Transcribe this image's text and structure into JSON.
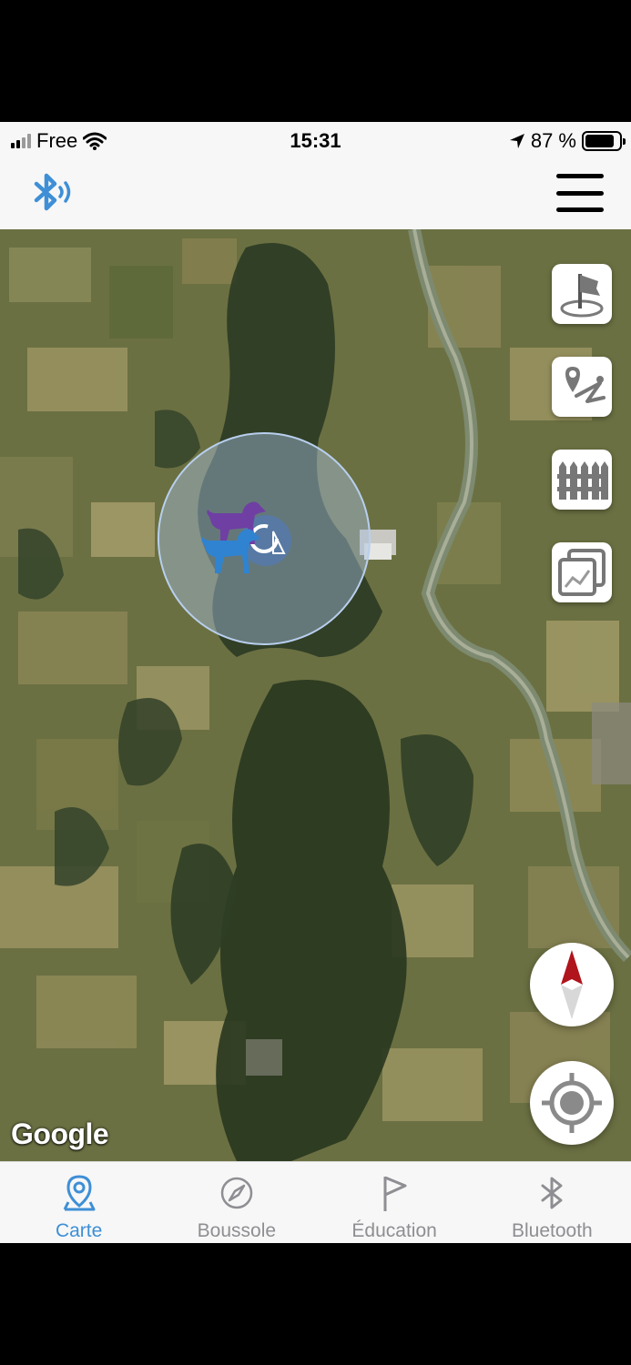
{
  "status_bar": {
    "carrier": "Free",
    "time": "15:31",
    "battery": "87 %",
    "battery_level": 0.87
  },
  "header": {
    "bluetooth_icon": "bluetooth-signal-icon",
    "menu_icon": "hamburger-menu-icon"
  },
  "map": {
    "tools": [
      {
        "name": "flag-location-tool",
        "icon": "flag-pin-icon"
      },
      {
        "name": "route-tool",
        "icon": "route-path-icon"
      },
      {
        "name": "fence-tool",
        "icon": "fence-icon"
      },
      {
        "name": "map-layers-tool",
        "icon": "layers-icon"
      }
    ],
    "compass_icon": "compass-needle-icon",
    "locate_icon": "locate-me-icon",
    "attribution": "Google"
  },
  "tabs": [
    {
      "label": "Carte",
      "icon": "map-pin-icon",
      "active": true
    },
    {
      "label": "Boussole",
      "icon": "compass-icon",
      "active": false
    },
    {
      "label": "Éducation",
      "icon": "flag-icon",
      "active": false
    },
    {
      "label": "Bluetooth",
      "icon": "bluetooth-icon",
      "active": false
    }
  ],
  "colors": {
    "accent": "#3e8fd6",
    "tab_inactive": "#8e8e93",
    "dog_purple": "#6f3fa4",
    "dog_blue": "#2f83d0",
    "compass_red": "#b0141c"
  }
}
